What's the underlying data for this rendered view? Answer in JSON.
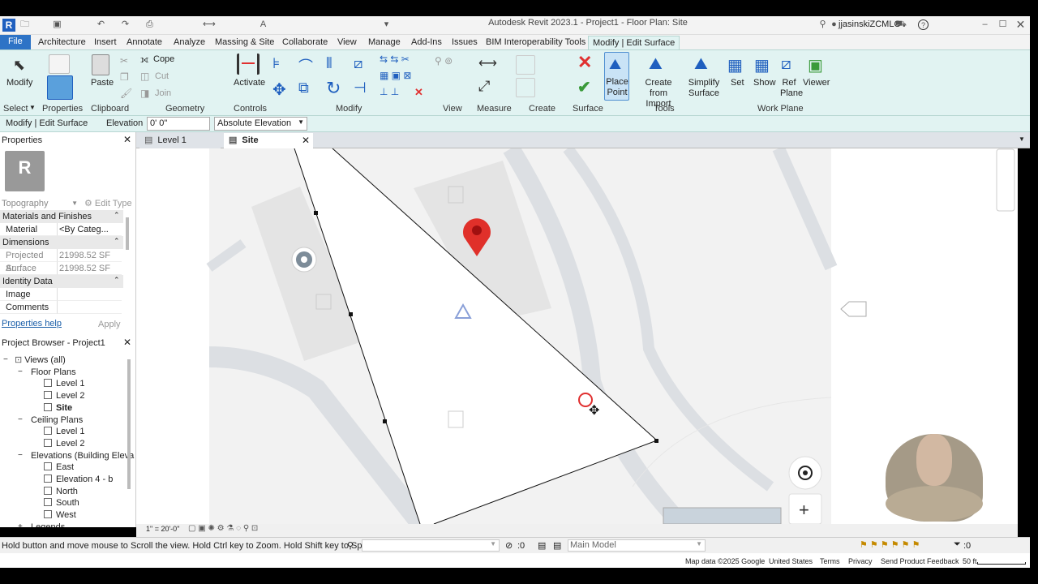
{
  "app": {
    "title": "Autodesk Revit 2023.1 - Project1 - Floor Plan: Site",
    "user": "jjasinskiZCMLC"
  },
  "menu": [
    "File",
    "Architecture",
    "Insert",
    "Annotate",
    "Analyze",
    "Massing & Site",
    "Collaborate",
    "View",
    "Manage",
    "Add-Ins",
    "Issues",
    "BIM Interoperability Tools",
    "Modify | Edit Surface"
  ],
  "ribbon": {
    "modify": "Modify",
    "select": "Select",
    "properties": "Properties",
    "paste": "Paste",
    "clipboard": "Clipboard",
    "cope": "Cope",
    "cut": "Cut",
    "join": "Join",
    "geometry": "Geometry",
    "activate": "Activate",
    "controls": "Controls",
    "modify_panel": "Modify",
    "view": "View",
    "measure": "Measure",
    "create": "Create",
    "surface": "Surface",
    "place_point": "Place Point",
    "create_from_import": "Create from Import",
    "simplify_surface": "Simplify Surface",
    "tools": "Tools",
    "set": "Set",
    "show": "Show",
    "ref_plane": "Ref Plane",
    "viewer": "Viewer",
    "work_plane": "Work Plane"
  },
  "options": {
    "context": "Modify | Edit Surface",
    "elevation_label": "Elevation",
    "elevation_value": "0'  0\"",
    "elevation_mode": "Absolute Elevation"
  },
  "properties": {
    "title": "Properties",
    "type": "Topography",
    "edit_type": "Edit Type",
    "sections": [
      {
        "name": "Materials and Finishes",
        "rows": [
          {
            "k": "Material",
            "v": "<By Categ..."
          }
        ]
      },
      {
        "name": "Dimensions",
        "rows": [
          {
            "k": "Projected Ar...",
            "v": "21998.52 SF"
          },
          {
            "k": "Surface Area",
            "v": "21998.52 SF"
          }
        ]
      },
      {
        "name": "Identity Data",
        "rows": [
          {
            "k": "Image",
            "v": ""
          },
          {
            "k": "Comments",
            "v": ""
          }
        ]
      }
    ],
    "help": "Properties help",
    "apply": "Apply"
  },
  "browser": {
    "title": "Project Browser - Project1",
    "items": [
      {
        "t": "Views (all)",
        "lvl": 0,
        "ex": "−"
      },
      {
        "t": "Floor Plans",
        "lvl": 1,
        "ex": "−"
      },
      {
        "t": "Level 1",
        "lvl": 2
      },
      {
        "t": "Level 2",
        "lvl": 2
      },
      {
        "t": "Site",
        "lvl": 2,
        "bold": true
      },
      {
        "t": "Ceiling Plans",
        "lvl": 1,
        "ex": "−"
      },
      {
        "t": "Level 1",
        "lvl": 2
      },
      {
        "t": "Level 2",
        "lvl": 2
      },
      {
        "t": "Elevations (Building Eleva",
        "lvl": 1,
        "ex": "−"
      },
      {
        "t": "East",
        "lvl": 2
      },
      {
        "t": "Elevation 4 - b",
        "lvl": 2
      },
      {
        "t": "North",
        "lvl": 2
      },
      {
        "t": "South",
        "lvl": 2
      },
      {
        "t": "West",
        "lvl": 2
      },
      {
        "t": "Legends",
        "lvl": 1,
        "ex": "+"
      }
    ]
  },
  "viewtabs": [
    {
      "label": "Level 1"
    },
    {
      "label": "Site",
      "active": true
    }
  ],
  "viewctl": {
    "scale": "1\" = 20'-0\""
  },
  "status": {
    "hint": "Hold button and move mouse to Scroll the view. Hold Ctrl key to Zoom. Hold Shift key to Spin.",
    "count": ":0",
    "model": "Main Model",
    "filter": ":0"
  },
  "map_footer": [
    "Map data ©2025 Google",
    "United States",
    "Terms",
    "Privacy",
    "Send Product Feedback",
    "50 ft"
  ],
  "colors": {
    "ribbon": "#e1f3f2",
    "file_tab": "#2d73c6",
    "pin": "#e0302a"
  }
}
